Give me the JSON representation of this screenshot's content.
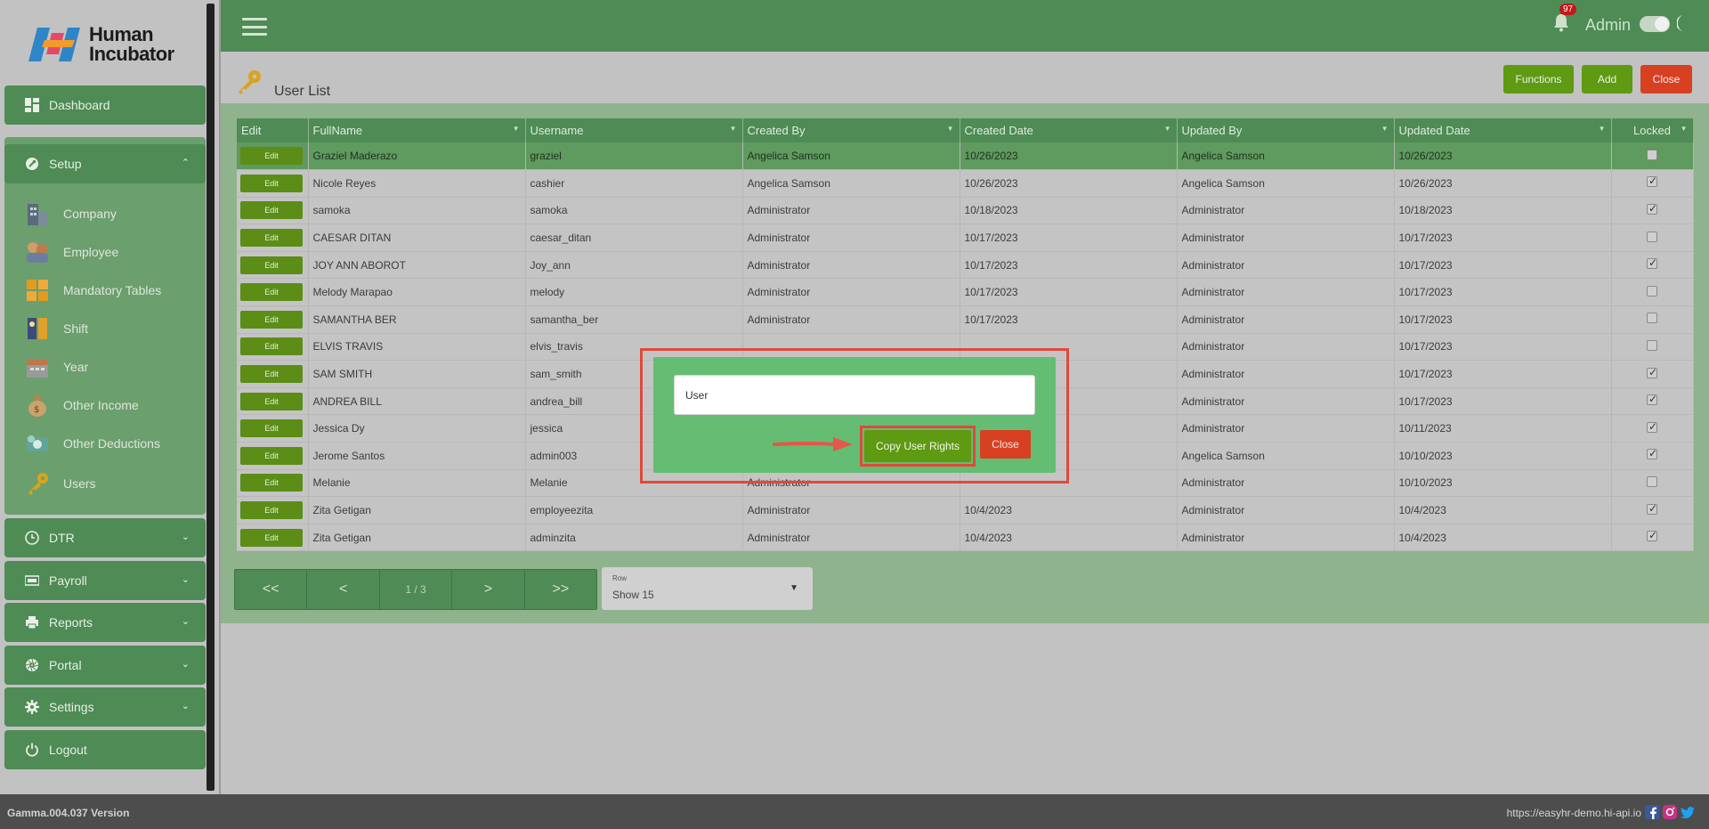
{
  "brand": {
    "line1": "Human",
    "line2": "Incubator"
  },
  "sidebar": {
    "dashboard": "Dashboard",
    "setup": "Setup",
    "setup_items": [
      "Company",
      "Employee",
      "Mandatory Tables",
      "Shift",
      "Year",
      "Other Income",
      "Other Deductions",
      "Users"
    ],
    "dtr": "DTR",
    "payroll": "Payroll",
    "reports": "Reports",
    "portal": "Portal",
    "settings": "Settings",
    "logout": "Logout"
  },
  "header": {
    "notifications_count": "97",
    "user": "Admin"
  },
  "page": {
    "title": "User List",
    "functions_label": "Functions",
    "add_label": "Add",
    "close_label": "Close"
  },
  "table": {
    "columns": [
      "Edit",
      "FullName",
      "Username",
      "Created By",
      "Created Date",
      "Updated By",
      "Updated Date",
      "Locked"
    ],
    "edit_label": "Edit",
    "rows": [
      {
        "fullname": "Graziel Maderazo",
        "username": "graziel",
        "created_by": "Angelica Samson",
        "created_date": "10/26/2023",
        "updated_by": "Angelica Samson",
        "updated_date": "10/26/2023",
        "locked": false
      },
      {
        "fullname": "Nicole Reyes",
        "username": "cashier",
        "created_by": "Angelica Samson",
        "created_date": "10/26/2023",
        "updated_by": "Angelica Samson",
        "updated_date": "10/26/2023",
        "locked": true
      },
      {
        "fullname": "samoka",
        "username": "samoka",
        "created_by": "Administrator",
        "created_date": "10/18/2023",
        "updated_by": "Administrator",
        "updated_date": "10/18/2023",
        "locked": true
      },
      {
        "fullname": "CAESAR DITAN",
        "username": "caesar_ditan",
        "created_by": "Administrator",
        "created_date": "10/17/2023",
        "updated_by": "Administrator",
        "updated_date": "10/17/2023",
        "locked": false
      },
      {
        "fullname": "JOY ANN ABOROT",
        "username": "Joy_ann",
        "created_by": "Administrator",
        "created_date": "10/17/2023",
        "updated_by": "Administrator",
        "updated_date": "10/17/2023",
        "locked": true
      },
      {
        "fullname": "Melody Marapao",
        "username": "melody",
        "created_by": "Administrator",
        "created_date": "10/17/2023",
        "updated_by": "Administrator",
        "updated_date": "10/17/2023",
        "locked": false
      },
      {
        "fullname": "SAMANTHA BER",
        "username": "samantha_ber",
        "created_by": "Administrator",
        "created_date": "10/17/2023",
        "updated_by": "Administrator",
        "updated_date": "10/17/2023",
        "locked": false
      },
      {
        "fullname": "ELVIS TRAVIS",
        "username": "elvis_travis",
        "created_by": "",
        "created_date": "",
        "updated_by": "Administrator",
        "updated_date": "10/17/2023",
        "locked": false
      },
      {
        "fullname": "SAM SMITH",
        "username": "sam_smith",
        "created_by": "",
        "created_date": "",
        "updated_by": "Administrator",
        "updated_date": "10/17/2023",
        "locked": true
      },
      {
        "fullname": "ANDREA BILL",
        "username": "andrea_bill",
        "created_by": "",
        "created_date": "",
        "updated_by": "Administrator",
        "updated_date": "10/17/2023",
        "locked": true
      },
      {
        "fullname": "Jessica Dy",
        "username": "jessica",
        "created_by": "",
        "created_date": "",
        "updated_by": "Administrator",
        "updated_date": "10/11/2023",
        "locked": true
      },
      {
        "fullname": "Jerome Santos",
        "username": "admin003",
        "created_by": "",
        "created_date": "",
        "updated_by": "Angelica Samson",
        "updated_date": "10/10/2023",
        "locked": true
      },
      {
        "fullname": "Melanie",
        "username": "Melanie",
        "created_by": "Administrator",
        "created_date": "",
        "updated_by": "Administrator",
        "updated_date": "10/10/2023",
        "locked": false
      },
      {
        "fullname": "Zita Getigan",
        "username": "employeezita",
        "created_by": "Administrator",
        "created_date": "10/4/2023",
        "updated_by": "Administrator",
        "updated_date": "10/4/2023",
        "locked": true
      },
      {
        "fullname": "Zita Getigan",
        "username": "adminzita",
        "created_by": "Administrator",
        "created_date": "10/4/2023",
        "updated_by": "Administrator",
        "updated_date": "10/4/2023",
        "locked": true
      }
    ]
  },
  "pager": {
    "first": "<<",
    "prev": "<",
    "page": "1 / 3",
    "next": ">",
    "last": ">>"
  },
  "rows_select": {
    "label": "Row",
    "value": "Show 15"
  },
  "modal": {
    "input_value": "User",
    "copy_label": "Copy User Rights",
    "close_label": "Close"
  },
  "footer": {
    "version": "Gamma.004.037 Version",
    "url": "https://easyhr-demo.hi-api.io"
  },
  "colors": {
    "primary_green": "#4e8b55",
    "action_green": "#5e9a12",
    "danger": "#d84022",
    "highlight": "#e0493c",
    "modal_bg": "#64bd72"
  }
}
